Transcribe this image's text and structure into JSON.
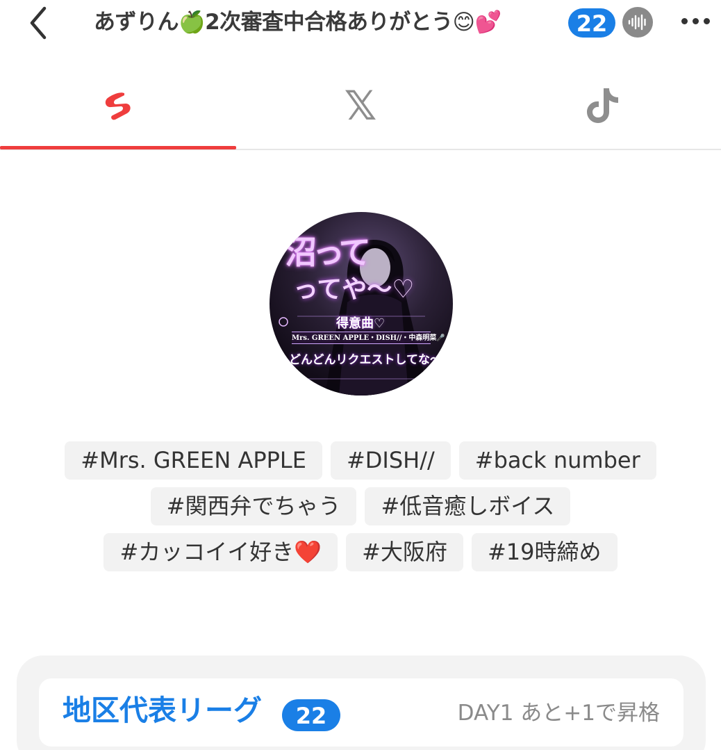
{
  "header": {
    "title": "あずりん🍏2次審査中合格ありがとう😊💕",
    "badge_count": "22",
    "back_icon": "chevron-left-icon",
    "voice_icon": "waveform-icon",
    "more_icon": "more-horizontal-icon"
  },
  "tabs": [
    {
      "icon": "shorts-icon",
      "active": true
    },
    {
      "icon": "x-logo-icon",
      "glyph": "𝕏",
      "active": false
    },
    {
      "icon": "tiktok-icon",
      "active": false
    }
  ],
  "avatar": {
    "text_line1": "沼って",
    "text_line2": "ってや〜♡",
    "text_line3": "得意曲♡",
    "text_line4": "Mrs. GREEN APPLE・DISH//・中森明菜🎤",
    "text_line5": "どんどんリクエストしてな〜🥰"
  },
  "tags": {
    "row1": [
      "#Mrs. GREEN APPLE",
      "#DISH//",
      "#back number"
    ],
    "row2": [
      "#関西弁でちゃう",
      "#低音癒しボイス"
    ],
    "row3": [
      "#カッコイイ好き❤️",
      "#大阪府",
      "#19時締め"
    ]
  },
  "league": {
    "title": "地区代表リーグ",
    "badge": "22",
    "status": "DAY1 あと+1で昇格"
  },
  "colors": {
    "accent_red": "#ef3d3d",
    "accent_blue": "#1a7fe6",
    "tag_bg": "#f2f2f2",
    "icon_gray": "#8e8e8e"
  }
}
